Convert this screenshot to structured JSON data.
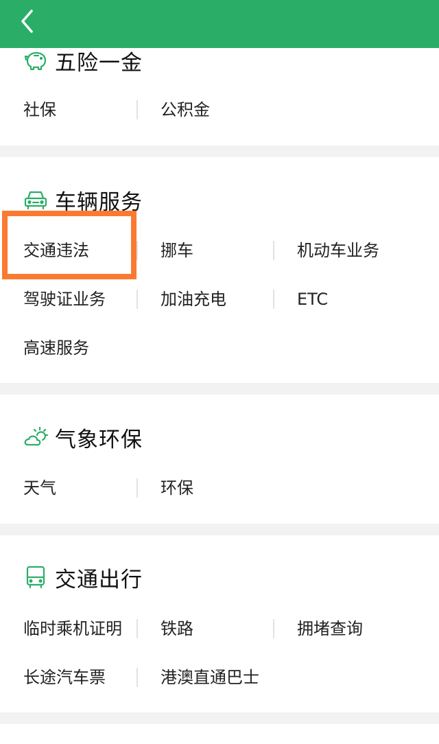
{
  "header": {
    "back_icon": "chevron-left-icon",
    "color": "#2aae67"
  },
  "accent": "#2aae67",
  "highlight_color": "#fb7a31",
  "sections": {
    "insurance": {
      "icon": "piggy-bank-icon",
      "title": "五险一金",
      "items": [
        "社保",
        "公积金"
      ]
    },
    "vehicle": {
      "icon": "car-icon",
      "title": "车辆服务",
      "items": [
        "交通违法",
        "挪车",
        "机动车业务",
        "驾驶证业务",
        "加油充电",
        "ETC",
        "高速服务"
      ]
    },
    "weather": {
      "icon": "weather-cloud-sun-icon",
      "title": "气象环保",
      "items": [
        "天气",
        "环保"
      ]
    },
    "transport": {
      "icon": "bus-icon",
      "title": "交通出行",
      "items": [
        "临时乘机证明",
        "铁路",
        "拥堵查询",
        "长途汽车票",
        "港澳直通巴士"
      ]
    }
  }
}
